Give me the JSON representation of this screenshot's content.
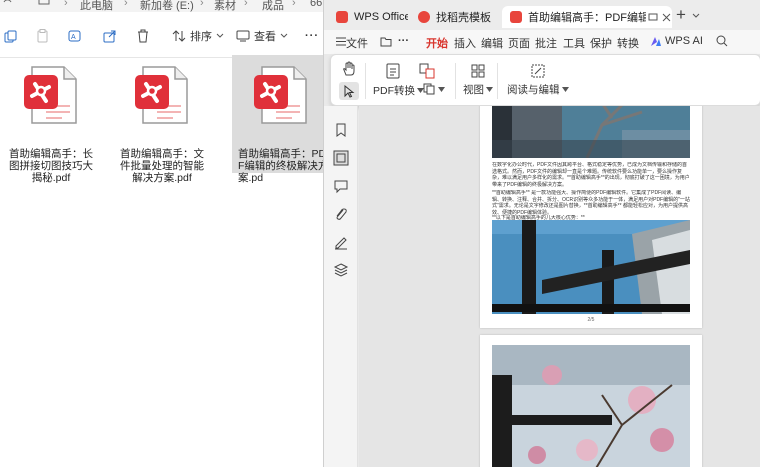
{
  "explorer": {
    "breadcrumb": [
      "此电脑",
      "新加卷 (E:)",
      "素材",
      "成品",
      "66"
    ],
    "toolbar": {
      "sort_label": "排序",
      "view_label": "查看",
      "more_label": "···"
    },
    "files": [
      {
        "name": "首助编辑高手：长图拼接切图技巧大揭秘.pdf",
        "selected": false
      },
      {
        "name": "首助编辑高手：文件批量处理的智能解决方案.pdf",
        "selected": false
      },
      {
        "name": "首助编辑高手：PDF编辑的终极解决方案.pd",
        "selected": true
      }
    ]
  },
  "wps": {
    "tabs": [
      {
        "label": "WPS Office",
        "logo_color": "#e8453c"
      },
      {
        "label": "找稻壳模板",
        "logo_color": "#e8453c"
      },
      {
        "label": "首助编辑高手：PDF编辑的终",
        "logo_color": "#e8453c",
        "active": true
      }
    ],
    "tab_plus": "+",
    "menu": {
      "file_label": "文件",
      "more_dots": "···",
      "items": [
        "开始",
        "插入",
        "编辑",
        "页面",
        "批注",
        "工具",
        "保护",
        "转换"
      ],
      "active_item": "开始",
      "ai_label": "WPS AI"
    },
    "ribbon": {
      "pdf_convert_label": "PDF转换",
      "view_label": "视图",
      "read_edit_label": "阅读与编辑"
    },
    "document": {
      "paragraph1": "在数字化办公时代，PDF文件因其跨平台、格式稳定等优势，已成为文档传输和存储的首选格式。然而，PDF文件的编辑却一直是个难题。传统软件要么功能单一，要么操作复杂，难以满足用户多样化的需求。**首助编辑高手**的出现，彻底打破了这一困境，为用户带来了PDF编辑的终极解决方案。",
      "paragraph2": "**首助编辑高手** 是一款功能强大、操作简便的PDF编辑软件。它集成了PDF阅读、编辑、转换、注释、合并、拆分、OCR识别等众多功能于一体，满足用户对PDF编辑的\"一站式\"需求。无论是文字修改还是图片替换，**首助编辑高手** 都能轻松应对，为用户提供高效、便捷的PDF编辑体验。",
      "paragraph3": "**以下是首助编辑高手的几大核心优势：**",
      "page_number": "2/5",
      "accent": "#d9352d"
    }
  }
}
